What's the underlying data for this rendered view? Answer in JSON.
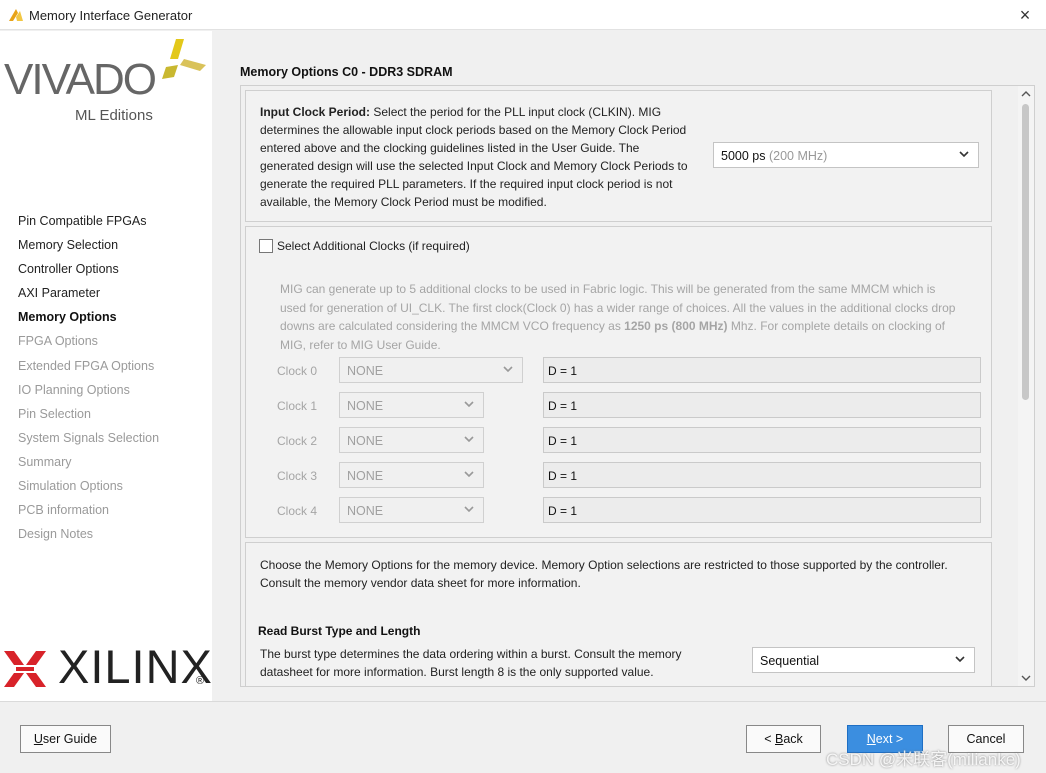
{
  "window": {
    "title": "Memory Interface Generator",
    "close_glyph": "×"
  },
  "logos": {
    "vivado_word": "VIVADO",
    "vivado_sub": "ML Editions",
    "xilinx_word": "XILINX",
    "xilinx_reg": "®"
  },
  "sidebar": {
    "items": [
      {
        "label": "Pin Compatible FPGAs",
        "state": "done"
      },
      {
        "label": "Memory Selection",
        "state": "done"
      },
      {
        "label": "Controller Options",
        "state": "done"
      },
      {
        "label": "AXI Parameter",
        "state": "done"
      },
      {
        "label": "Memory Options",
        "state": "active"
      },
      {
        "label": "FPGA Options",
        "state": "pending"
      },
      {
        "label": "Extended FPGA Options",
        "state": "pending"
      },
      {
        "label": "IO Planning Options",
        "state": "pending"
      },
      {
        "label": "Pin Selection",
        "state": "pending"
      },
      {
        "label": "System Signals Selection",
        "state": "pending"
      },
      {
        "label": "Summary",
        "state": "pending"
      },
      {
        "label": "Simulation Options",
        "state": "pending"
      },
      {
        "label": "PCB information",
        "state": "pending"
      },
      {
        "label": "Design Notes",
        "state": "pending"
      }
    ]
  },
  "main": {
    "header": "Memory Options C0 - DDR3 SDRAM",
    "input_clock": {
      "label_bold": "Input Clock Period:",
      "line1": " Select the period for the PLL input clock (CLKIN). MIG",
      "line2": "determines the allowable input clock periods based on the Memory Clock Period",
      "line3": "entered above and the clocking guidelines listed in the User Guide. The",
      "line4": "generated design will use the selected Input Clock and Memory Clock Periods to",
      "line5": "generate the required PLL parameters. If the required input clock period is not",
      "line6": "available, the Memory Clock Period must be modified.",
      "select_value": "5000 ps",
      "select_hint": "(200 MHz)"
    },
    "additional_clocks": {
      "checkbox_label": "Select Additional Clocks (if required)",
      "checked": false,
      "desc_line1": "MIG can generate up to 5 additional clocks to be used in Fabric logic. This will be generated from the same MMCM which is",
      "desc_line2": "used for generation of UI_CLK. The first clock(Clock 0) has a wider range of choices. All the values in the additional clocks drop",
      "desc_line3a": "downs are calculated considering the MMCM VCO frequency as ",
      "desc_line3b": "1250 ps (800 MHz)",
      "desc_line3c": " Mhz. For complete details on clocking of",
      "desc_line4": "MIG, refer to MIG User Guide.",
      "clocks": [
        {
          "label": "Clock 0",
          "value": "NONE",
          "divider": "D = 1"
        },
        {
          "label": "Clock 1",
          "value": "NONE",
          "divider": "D = 1"
        },
        {
          "label": "Clock 2",
          "value": "NONE",
          "divider": "D = 1"
        },
        {
          "label": "Clock 3",
          "value": "NONE",
          "divider": "D = 1"
        },
        {
          "label": "Clock 4",
          "value": "NONE",
          "divider": "D = 1"
        }
      ]
    },
    "memory_options": {
      "intro_line1": "Choose the Memory Options for the memory device. Memory Option selections are restricted to those supported by the controller.",
      "intro_line2": "Consult the memory vendor data sheet for more information.",
      "burst_heading": "Read Burst Type and Length",
      "burst_line1": "The burst type determines the data ordering within a burst. Consult the memory",
      "burst_line2": "datasheet for more information. Burst length 8 is the only supported value.",
      "burst_value": "Sequential"
    }
  },
  "footer": {
    "user_guide_u": "U",
    "user_guide_rest": "ser Guide",
    "back_pre": "< ",
    "back_u": "B",
    "back_rest": "ack",
    "next_u": "N",
    "next_rest": "ext >",
    "cancel": "Cancel"
  },
  "watermark": "CSDN @米联客(milianke)",
  "colors": {
    "primary_button": "#3b8ee0",
    "vivado_arrow_yellow": "#e3c81a",
    "xilinx_red": "#d8232a"
  }
}
